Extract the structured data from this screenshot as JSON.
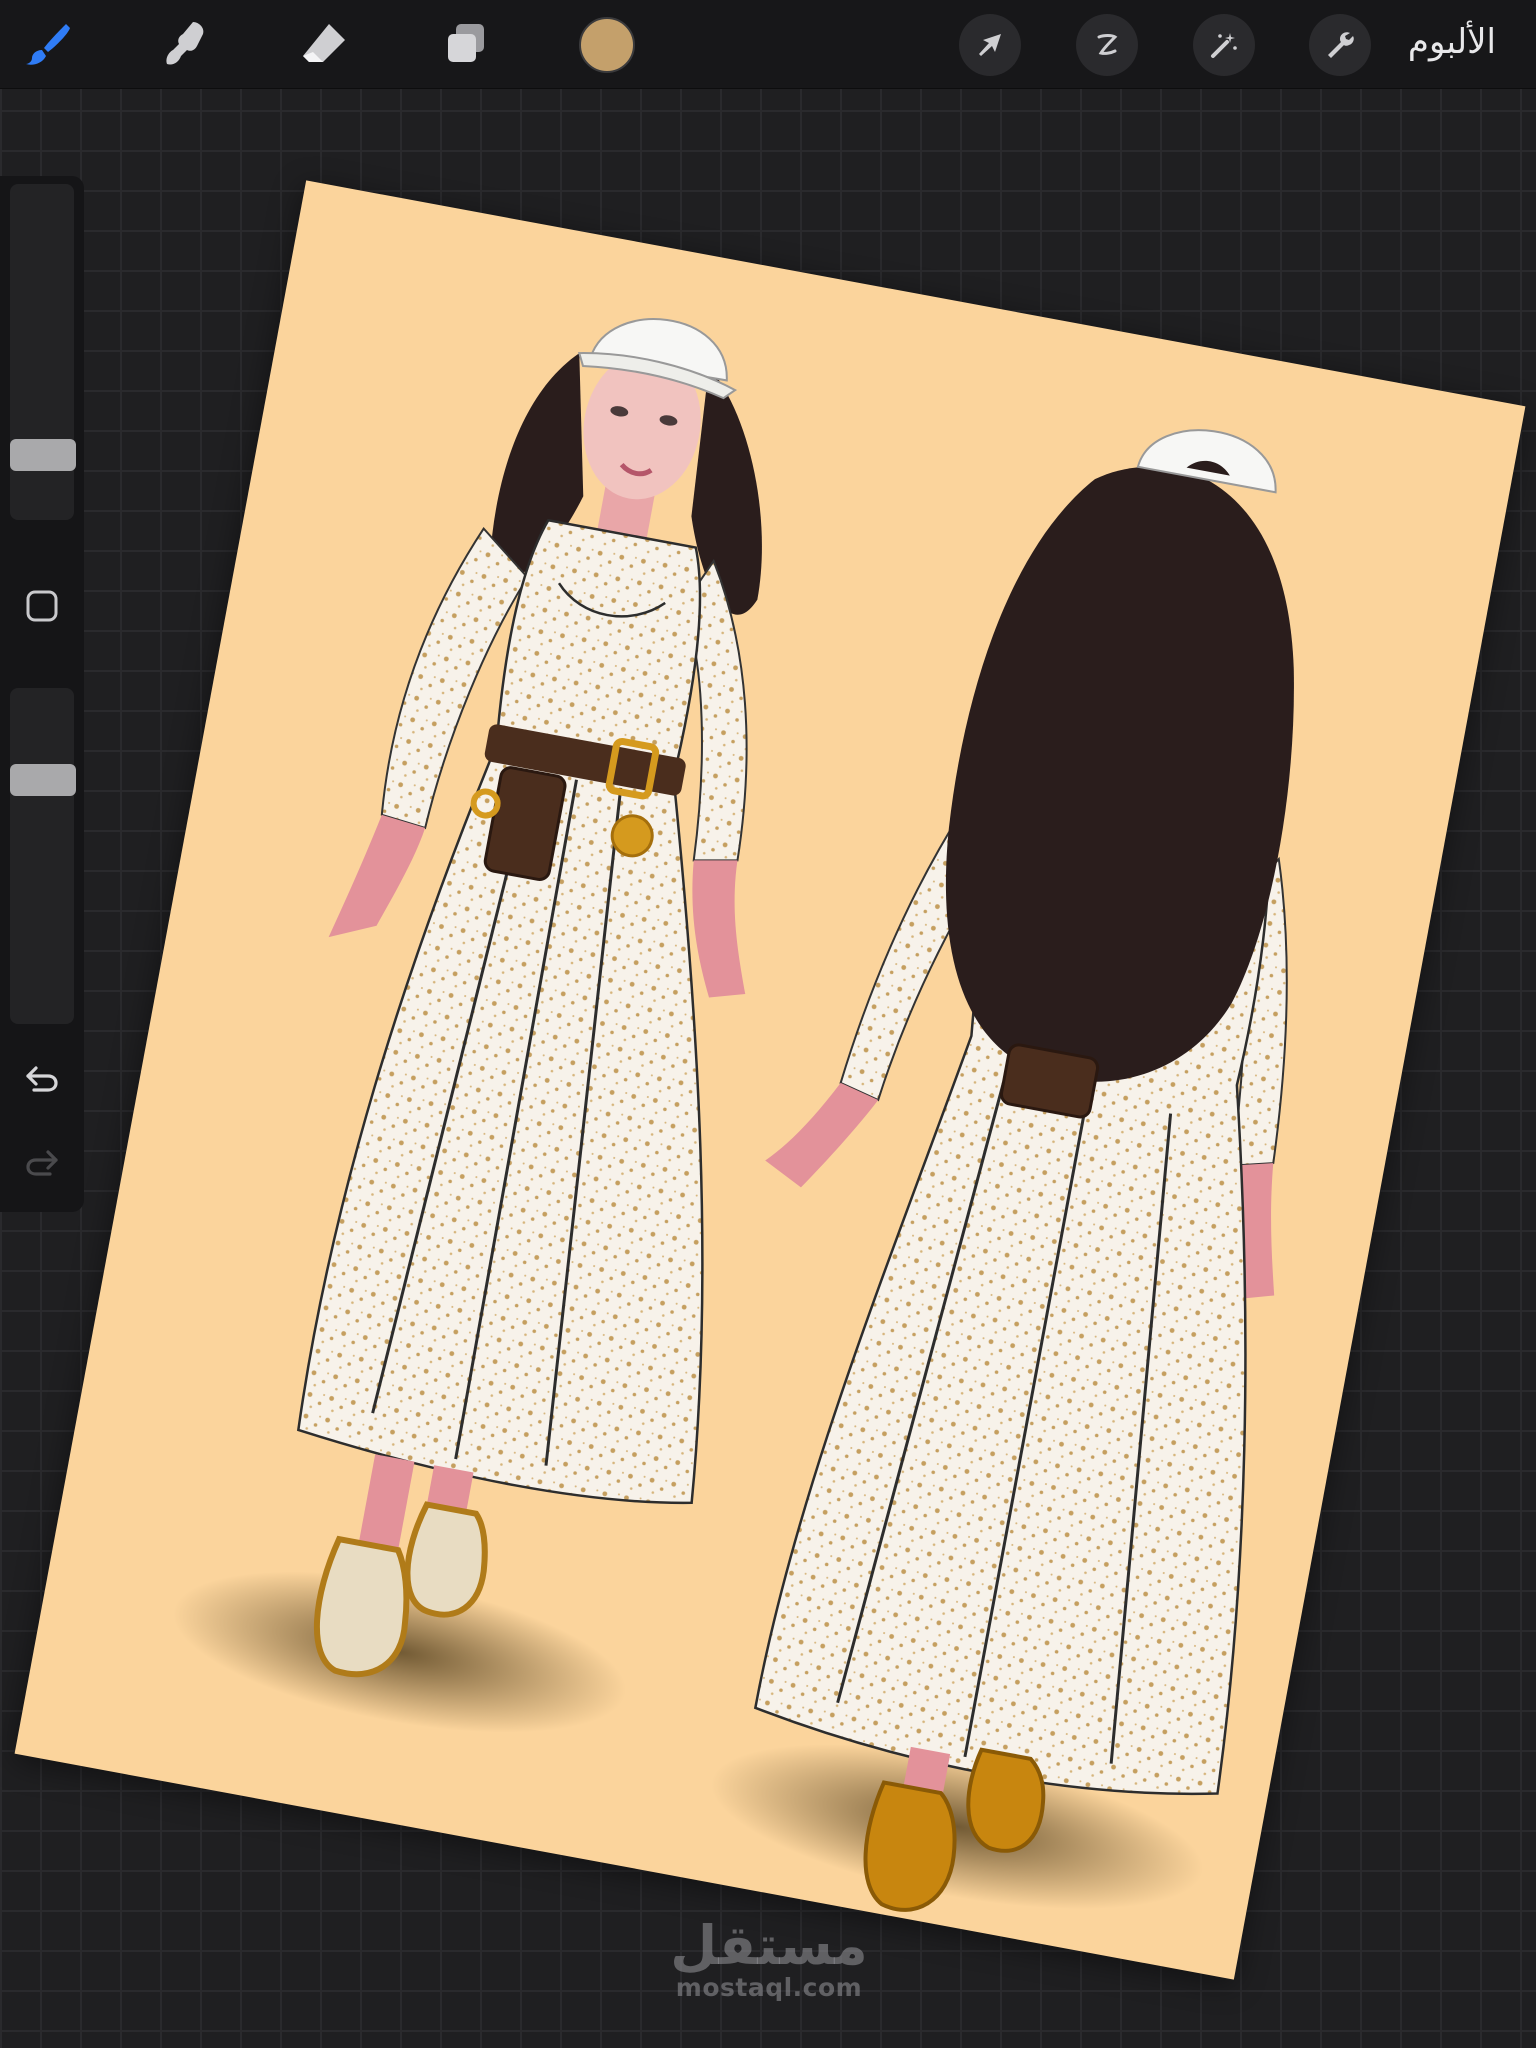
{
  "toolbar": {
    "gallery_label": "الألبوم",
    "tools": [
      {
        "name": "brush-icon",
        "active": true
      },
      {
        "name": "smudge-icon",
        "active": false
      },
      {
        "name": "eraser-icon",
        "active": false
      },
      {
        "name": "layers-icon",
        "active": false
      }
    ],
    "actions": [
      {
        "name": "transform-arrow-icon"
      },
      {
        "name": "selection-icon"
      },
      {
        "name": "adjustments-wand-icon"
      },
      {
        "name": "settings-wrench-icon"
      }
    ],
    "current_color": "#c4a06b",
    "active_tool_color": "#2f7cf6"
  },
  "sidebar": {
    "brush_size_level": 0.84,
    "opacity_level": 0.25,
    "controls": [
      "modify-square-icon",
      "undo-icon",
      "redo-icon"
    ]
  },
  "watermark": {
    "main": "مستقل",
    "sub": "mostaql.com"
  },
  "colors": {
    "canvas_bg": "#fbd49c",
    "workspace_bg": "#1f1f21",
    "hair": "#2a1d1c",
    "dress": "#f7f2ea",
    "dress_pattern": "#c59f5f",
    "belt": "#4a2d1d",
    "gold": "#d59a1e",
    "skin": "#e3929a",
    "sneaker_front": "#e8dcc2",
    "sneaker_back": "#c8860f"
  }
}
